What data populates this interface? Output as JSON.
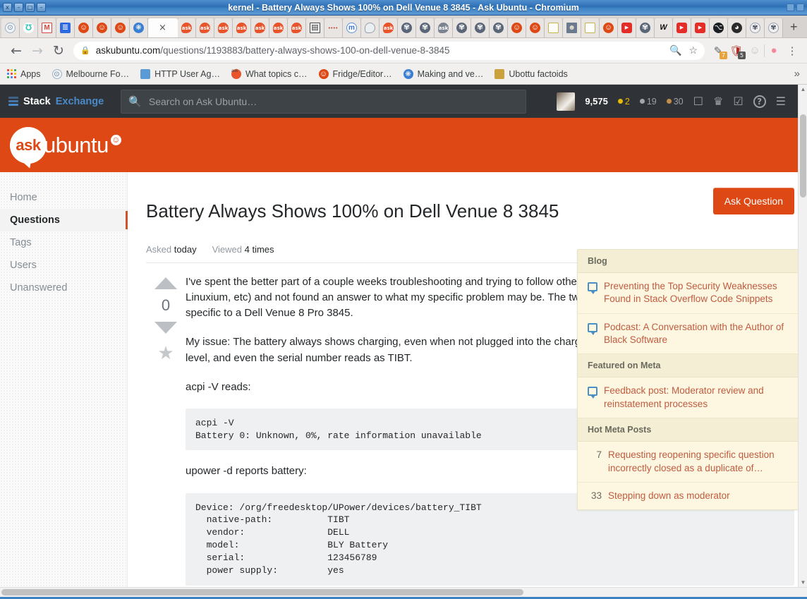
{
  "window": {
    "title": "kernel - Battery Always Shows 100% on Dell Venue 8 3845 - Ask Ubuntu - Chromium",
    "buttons": [
      "x",
      "–",
      "□",
      "–"
    ]
  },
  "browser": {
    "tabs": [
      {
        "name": "pinned-tab-disc",
        "icon": "pin-icon"
      },
      {
        "name": "pinned-tab-teal",
        "icon": "teal-icon"
      },
      {
        "name": "pinned-tab-gmail",
        "icon": "gmail-icon"
      },
      {
        "name": "pinned-tab-notes",
        "icon": "notes-icon"
      },
      {
        "name": "pinned-tab-ubuntu-1",
        "icon": "ubuntu-icon"
      },
      {
        "name": "pinned-tab-ubuntu-2",
        "icon": "ubuntu-icon"
      },
      {
        "name": "pinned-tab-ubuntu-3",
        "icon": "ubuntu-icon"
      },
      {
        "name": "pinned-tab-firefox",
        "icon": "firefox-icon"
      },
      {
        "name": "active-tab-askubuntu",
        "icon": "close-icon",
        "active": true
      },
      {
        "name": "tab-ask-1",
        "icon": "askubuntu-icon"
      },
      {
        "name": "tab-ask-2",
        "icon": "askubuntu-icon"
      },
      {
        "name": "tab-ask-3",
        "icon": "askubuntu-icon"
      },
      {
        "name": "tab-ask-4",
        "icon": "askubuntu-icon"
      },
      {
        "name": "tab-ask-5",
        "icon": "askubuntu-icon"
      },
      {
        "name": "tab-ask-6",
        "icon": "askubuntu-icon"
      },
      {
        "name": "tab-ask-7",
        "icon": "askubuntu-icon"
      },
      {
        "name": "tab-document",
        "icon": "document-icon"
      },
      {
        "name": "tab-dots",
        "icon": "dots-icon"
      },
      {
        "name": "tab-mastodon",
        "icon": "mastodon-icon"
      },
      {
        "name": "tab-chat",
        "icon": "chat-icon"
      },
      {
        "name": "tab-ask-8",
        "icon": "askubuntu-icon"
      },
      {
        "name": "tab-gear-1",
        "icon": "gear-icon"
      },
      {
        "name": "tab-gear-2",
        "icon": "gear-icon"
      },
      {
        "name": "tab-ask-gray",
        "icon": "askubuntu-gray-icon"
      },
      {
        "name": "tab-gear-3",
        "icon": "gear-icon"
      },
      {
        "name": "tab-gear-4",
        "icon": "gear-icon"
      },
      {
        "name": "tab-gear-5",
        "icon": "gear-icon"
      },
      {
        "name": "tab-ubuntu-4",
        "icon": "ubuntu-icon"
      },
      {
        "name": "tab-ubuntu-5",
        "icon": "ubuntu-icon"
      },
      {
        "name": "tab-launchpad-1",
        "icon": "launchpad-icon"
      },
      {
        "name": "tab-photo",
        "icon": "photo-icon"
      },
      {
        "name": "tab-launchpad-2",
        "icon": "launchpad-icon"
      },
      {
        "name": "tab-ubuntu-6",
        "icon": "ubuntu-icon"
      },
      {
        "name": "tab-youtube-1",
        "icon": "youtube-icon"
      },
      {
        "name": "tab-gear-6",
        "icon": "gear-icon"
      },
      {
        "name": "tab-w",
        "icon": "w-icon"
      },
      {
        "name": "tab-youtube-2",
        "icon": "youtube-icon"
      },
      {
        "name": "tab-youtube-3",
        "icon": "youtube-icon"
      },
      {
        "name": "tab-github",
        "icon": "github-icon"
      },
      {
        "name": "tab-globe",
        "icon": "globe-icon"
      },
      {
        "name": "tab-gear-7",
        "icon": "gear-icon"
      },
      {
        "name": "tab-gear-8",
        "icon": "gear-icon"
      }
    ],
    "new_tab_label": "+",
    "tab_close_label": "×",
    "nav": {
      "back": "←",
      "forward": "→",
      "reload": "↻"
    },
    "omnibox": {
      "lock_icon": "lock-icon",
      "url_host": "askubuntu.com",
      "url_path": "/questions/1193883/battery-always-shows-100-on-dell-venue-8-3845",
      "zoom_icon": "zoom-in-icon",
      "bookmark_icon": "star-icon"
    },
    "extensions": [
      {
        "name": "extension-highlighter",
        "glyph": "✎",
        "badge": "7",
        "badge_color": "#e8a33d"
      },
      {
        "name": "extension-ublock-origin",
        "glyph": "⛨",
        "badge": "5",
        "badge_color": "#555555"
      },
      {
        "name": "extension-profile",
        "glyph": "●",
        "badge": ""
      }
    ],
    "profile_icon": "profile-avatar-icon",
    "menu_icon": "three-dot-menu-icon",
    "bookmarks": [
      {
        "label": "Apps",
        "icon": "apps-grid-icon"
      },
      {
        "label": "Melbourne Fo…",
        "icon": "disc-icon"
      },
      {
        "label": "HTTP User Ag…",
        "icon": "globe-blue-icon"
      },
      {
        "label": "What topics c…",
        "icon": "askubuntu-icon"
      },
      {
        "label": "Fridge/Editor…",
        "icon": "ubuntu-icon"
      },
      {
        "label": "Making and ve…",
        "icon": "person-blue-icon"
      },
      {
        "label": "Ubottu factoids",
        "icon": "robot-icon"
      }
    ],
    "bookmarks_overflow": "»"
  },
  "se_bar": {
    "logo_text_1": "Stack",
    "logo_text_2": "Exchange",
    "logo_icon": "stack-logo-icon",
    "search": {
      "placeholder": "Search on Ask Ubuntu…",
      "value": "",
      "icon": "search-icon"
    },
    "reputation": "9,575",
    "badges": [
      {
        "label": "2",
        "color": "#e8b904",
        "name": "gold-badge"
      },
      {
        "label": "19",
        "color": "#9fa6ad",
        "name": "silver-badge"
      },
      {
        "label": "30",
        "color": "#c18f4a",
        "name": "bronze-badge"
      }
    ],
    "icons": [
      {
        "name": "inbox-icon",
        "glyph": "☐"
      },
      {
        "name": "achievements-trophy-icon",
        "glyph": "♛"
      },
      {
        "name": "review-icon",
        "glyph": "☑"
      },
      {
        "name": "help-icon",
        "glyph": "?"
      },
      {
        "name": "site-switcher-icon",
        "glyph": "☰"
      }
    ]
  },
  "site_header": {
    "logo_ask": "ask",
    "logo_ubuntu": "ubuntu",
    "logo_mark": "☺",
    "brand_color": "#dd4814"
  },
  "sidebar": {
    "items": [
      {
        "label": "Home",
        "active": false
      },
      {
        "label": "Questions",
        "active": true
      },
      {
        "label": "Tags",
        "active": false
      },
      {
        "label": "Users",
        "active": false
      },
      {
        "label": "Unanswered",
        "active": false
      }
    ]
  },
  "question": {
    "title": "Battery Always Shows 100% on Dell Venue 8 3845",
    "ask_button": "Ask Question",
    "meta": {
      "asked_label": "Asked",
      "asked_value": "today",
      "viewed_label": "Viewed",
      "viewed_value": "4 times"
    },
    "votes": {
      "up_icon": "upvote-arrow-icon",
      "count": "0",
      "down_icon": "downvote-arrow-icon",
      "favorite_icon": "favorite-star-icon"
    },
    "body": {
      "para1": "I've spent the better part of a couple weeks troubleshooting and trying to follow other people's documentation (studioteabag.com, Linuxium, etc) and not found an answer to what my specific problem may be. The two mentioned above do not have information specific to a Dell Venue 8 Pro 3845.",
      "para1_bold": "3845",
      "para2": "My issue: The battery always shows charging, even when not plugged into the charger. It never shows the actual battery charge level, and even the serial number reads as TIBT.",
      "para3": "acpi -V reads:",
      "code1": "acpi -V\nBattery 0: Unknown, 0%, rate information unavailable",
      "para4": "upower -d reports battery:",
      "code2": "Device: /org/freedesktop/UPower/devices/battery_TIBT\n  native-path:          TIBT\n  vendor:               DELL\n  model:                BLY Battery\n  serial:               123456789\n  power supply:         yes"
    }
  },
  "bulletin": {
    "sections": [
      {
        "heading": "Blog",
        "items": [
          {
            "icon": "speech-bubble-icon",
            "text": "Preventing the Top Security Weaknesses Found in Stack Overflow Code Snippets"
          },
          {
            "icon": "speech-bubble-icon",
            "text": "Podcast: A Conversation with the Author of Black Software"
          }
        ]
      },
      {
        "heading": "Featured on Meta",
        "items": [
          {
            "icon": "speech-bubble-icon",
            "text": "Feedback post: Moderator review and reinstatement processes"
          }
        ]
      },
      {
        "heading": "Hot Meta Posts",
        "items": [
          {
            "score": "7",
            "text": "Requesting reopening specific question incorrectly closed as a duplicate of…"
          },
          {
            "score": "33",
            "text": "Stepping down as moderator"
          }
        ]
      }
    ]
  }
}
